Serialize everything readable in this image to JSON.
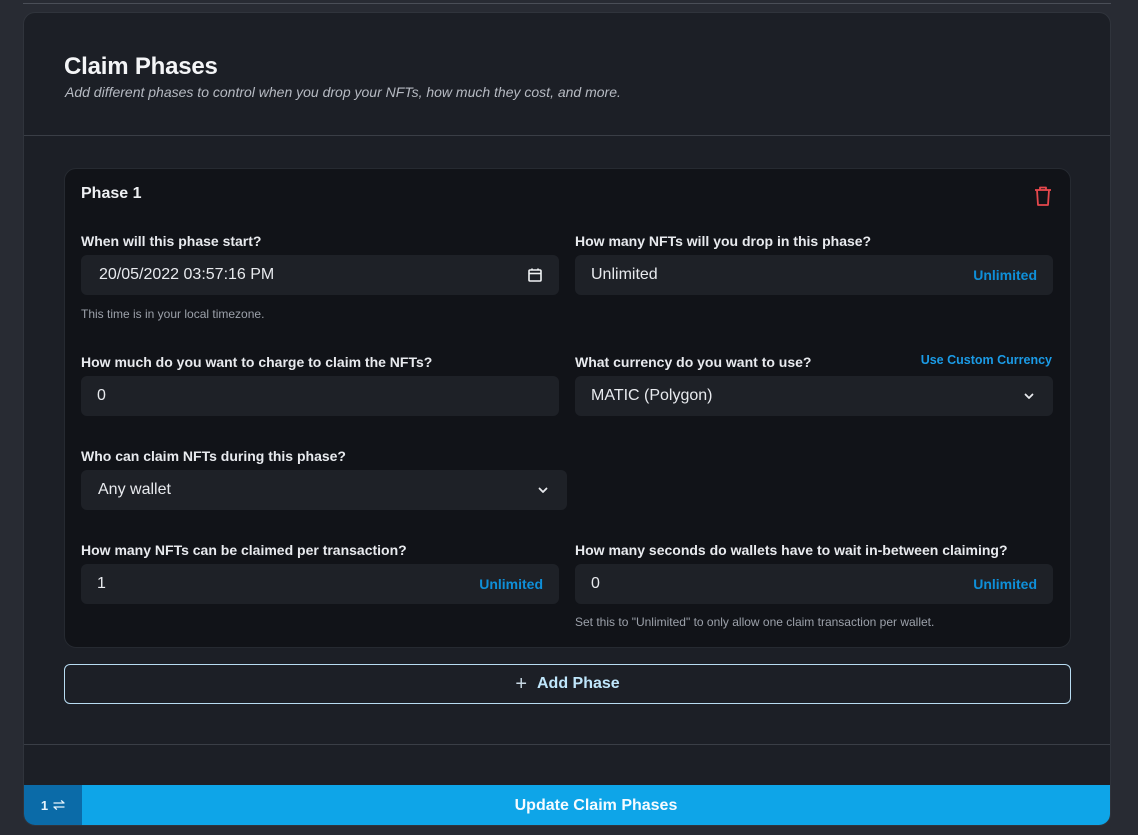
{
  "header": {
    "title": "Claim Phases",
    "subtitle": "Add different phases to control when you drop your NFTs, how much they cost, and more."
  },
  "phase": {
    "title": "Phase 1",
    "delete_icon": "trash-icon",
    "start": {
      "label": "When will this phase start?",
      "value": "20/05/2022 03:57:16 PM",
      "icon": "calendar-icon",
      "helper": "This time is in your local timezone."
    },
    "supply": {
      "label": "How many NFTs will you drop in this phase?",
      "value": "Unlimited",
      "action": "Unlimited"
    },
    "price": {
      "label": "How much do you want to charge to claim the NFTs?",
      "value": "0"
    },
    "currency": {
      "label": "What currency do you want to use?",
      "custom_link": "Use Custom Currency",
      "value": "MATIC (Polygon)",
      "icon": "chevron-down-icon"
    },
    "who_can_claim": {
      "label": "Who can claim NFTs during this phase?",
      "value": "Any wallet",
      "icon": "chevron-down-icon"
    },
    "per_transaction": {
      "label": "How many NFTs can be claimed per transaction?",
      "value": "1",
      "action": "Unlimited"
    },
    "wait_seconds": {
      "label": "How many seconds do wallets have to wait in-between claiming?",
      "value": "0",
      "action": "Unlimited",
      "helper": "Set this to \"Unlimited\" to only allow one claim transaction per wallet."
    }
  },
  "add_phase": {
    "icon": "plus-icon",
    "label": "Add Phase"
  },
  "footer": {
    "count": "1",
    "count_icon": "swap-arrows-icon",
    "submit_label": "Update Claim Phases"
  },
  "colors": {
    "accent": "#0ea5e8",
    "accent_dark": "#0b6ba8",
    "link": "#0f8fd8",
    "danger": "#e5484d"
  }
}
